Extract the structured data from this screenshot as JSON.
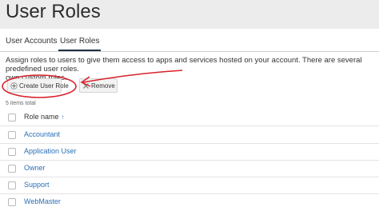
{
  "page": {
    "title": "User Roles"
  },
  "tabs": [
    {
      "label": "User Accounts",
      "active": false
    },
    {
      "label": "User Roles",
      "active": true
    }
  ],
  "description": {
    "line1": "Assign roles to users to give them access to apps and services hosted on your account. There are several predefined user roles.",
    "line2": "own custom roles."
  },
  "toolbar": {
    "create_label": "Create User Role",
    "remove_label": "Remove"
  },
  "list": {
    "count_text": "5 items total",
    "column_header": "Role name",
    "sort_indicator": "↑",
    "rows": [
      "Accountant",
      "Application User",
      "Owner",
      "Support",
      "WebMaster"
    ]
  },
  "colors": {
    "link": "#2b6fb6",
    "annotation": "#d9202a",
    "header_bg": "#ececec"
  }
}
